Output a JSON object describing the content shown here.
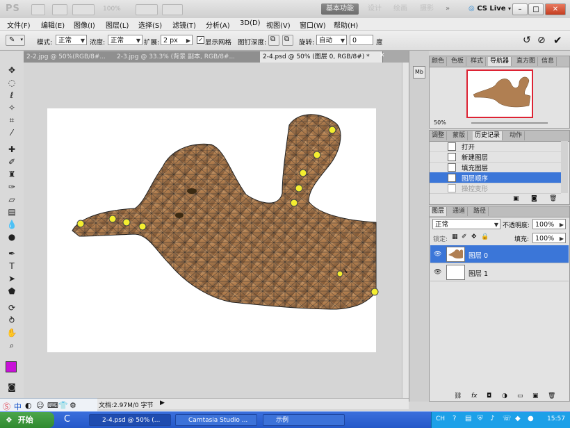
{
  "appbar": {
    "logo": "PS",
    "zoom": "100%",
    "workspaces": [
      "基本功能",
      "设计",
      "绘画",
      "摄影"
    ],
    "more": "»",
    "cslive": "CS Live",
    "win_min": "–",
    "win_max": "□",
    "win_close": "✕"
  },
  "menu": [
    "文件(F)",
    "编辑(E)",
    "图像(I)",
    "图层(L)",
    "选择(S)",
    "滤镜(T)",
    "分析(A)",
    "3D(D)",
    "视图(V)",
    "窗口(W)",
    "帮助(H)"
  ],
  "options": {
    "mode_label": "模式:",
    "mode_value": "正常",
    "density_label": "浓度:",
    "density_value": "正常",
    "expand_label": "扩展:",
    "expand_value": "2 px",
    "show_mesh_label": "显示网格",
    "pin_depth_label": "图钉深度:",
    "rotate_label": "旋转:",
    "rotate_mode": "自动",
    "rotate_value": "0",
    "degree": "度"
  },
  "doc_tabs": [
    {
      "label": "2-2.jpg @ 50%(RGB/8#..."
    },
    {
      "label": "2-3.jpg @ 33.3% (背景 副本, RGB/8#..."
    },
    {
      "label": "2-4.psd @ 50% (图层 0, RGB/8#) *"
    }
  ],
  "close_tab": "✕",
  "status": {
    "info": "文档:2.97M/0 字节"
  },
  "nav_panel": {
    "tabs": [
      "颜色",
      "色板",
      "样式",
      "导航器",
      "直方图",
      "信息"
    ],
    "zoom": "50%"
  },
  "history_panel": {
    "tabs": [
      "调整",
      "蒙版",
      "历史记录",
      "动作"
    ],
    "items": [
      "打开",
      "新建图层",
      "填充图层",
      "图层顺序",
      "操控变形"
    ]
  },
  "layers_panel": {
    "tabs": [
      "图层",
      "通道",
      "路径"
    ],
    "blend_mode": "正常",
    "opacity_label": "不透明度:",
    "opacity_value": "100%",
    "lock_label": "锁定:",
    "fill_label": "填充:",
    "fill_value": "100%",
    "layers": [
      "图层 0",
      "图层 1"
    ]
  },
  "taskbar": {
    "start": "开始",
    "tasks": [
      "2-4.psd @ 50% (...",
      "Camtasia Studio ...",
      "示例"
    ],
    "lang": "CH",
    "time": "15:57"
  },
  "colors": {
    "foreground": "#c812d8",
    "background": "#ffffff",
    "selection": "#3b76d8",
    "pin": "#f4ee30"
  }
}
